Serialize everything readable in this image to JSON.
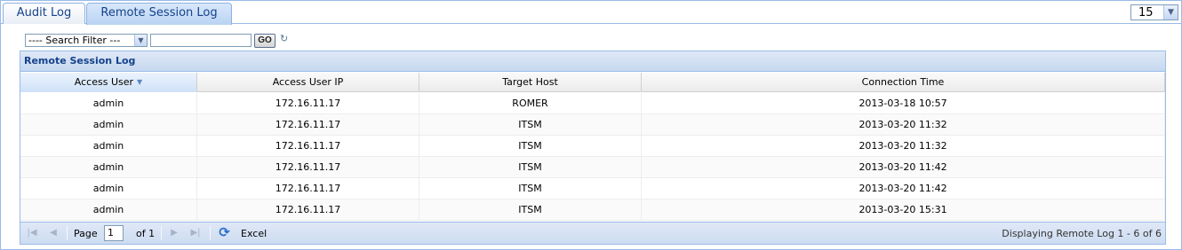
{
  "tabs": [
    {
      "label": "Audit Log",
      "active": false
    },
    {
      "label": "Remote Session Log",
      "active": true
    }
  ],
  "page_size": {
    "value": "15"
  },
  "filter": {
    "select_value": "---- Search Filter ---",
    "input_value": "",
    "go_label": "GO"
  },
  "grid": {
    "title": "Remote Session Log",
    "columns": [
      "Access User",
      "Access User IP",
      "Target Host",
      "Connection Time"
    ],
    "sorted_column": "Access User",
    "rows": [
      [
        "admin",
        "172.16.11.17",
        "ROMER",
        "2013-03-18 10:57"
      ],
      [
        "admin",
        "172.16.11.17",
        "ITSM",
        "2013-03-20 11:32"
      ],
      [
        "admin",
        "172.16.11.17",
        "ITSM",
        "2013-03-20 11:32"
      ],
      [
        "admin",
        "172.16.11.17",
        "ITSM",
        "2013-03-20 11:42"
      ],
      [
        "admin",
        "172.16.11.17",
        "ITSM",
        "2013-03-20 11:42"
      ],
      [
        "admin",
        "172.16.11.17",
        "ITSM",
        "2013-03-20 15:31"
      ]
    ]
  },
  "paging": {
    "page_label": "Page",
    "page_value": "1",
    "of_label": "of 1",
    "excel_label": "Excel",
    "display_message": "Displaying Remote Log 1 - 6 of 6"
  },
  "colors": {
    "border": "#99bbe8",
    "header_text": "#15428b"
  }
}
